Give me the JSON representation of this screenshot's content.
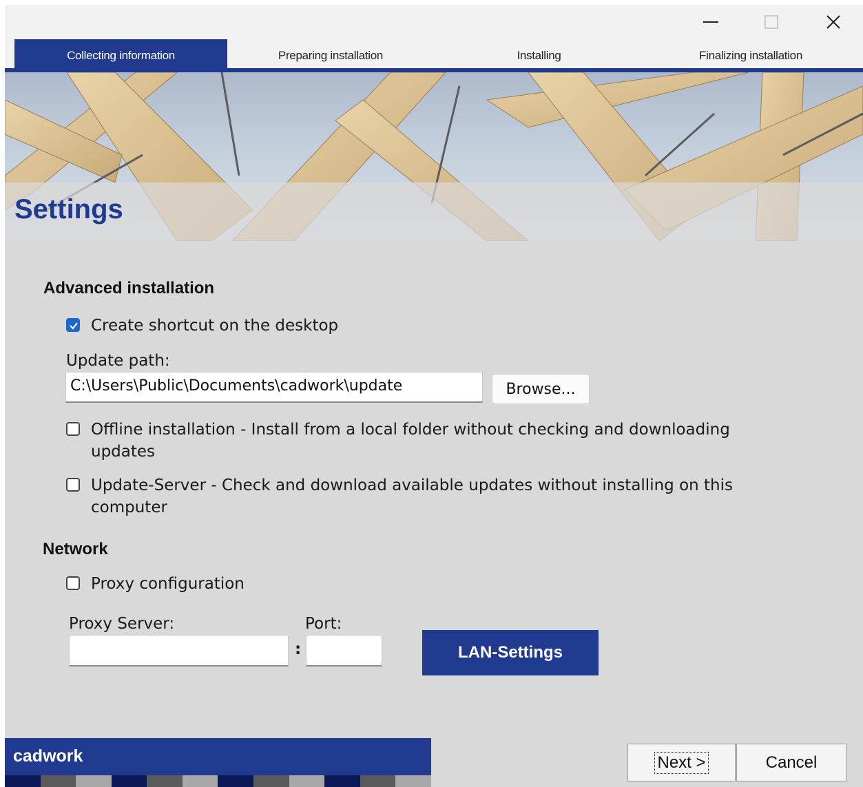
{
  "window": {
    "controls": {
      "minimize_icon": "minimize-icon",
      "maximize_icon": "maximize-icon",
      "close_icon": "close-icon"
    }
  },
  "steps": [
    {
      "label": "Collecting information",
      "active": true
    },
    {
      "label": "Preparing installation",
      "active": false
    },
    {
      "label": "Installing",
      "active": false
    },
    {
      "label": "Finalizing installation",
      "active": false
    }
  ],
  "page": {
    "title": "Settings"
  },
  "advanced": {
    "heading": "Advanced installation",
    "shortcut_label": "Create shortcut on the desktop",
    "shortcut_checked": true,
    "update_path_label": "Update path:",
    "update_path_value": "C:\\Users\\Public\\Documents\\cadwork\\update",
    "browse_label": "Browse...",
    "offline_label_line1": "Offline installation - Install from a local folder without checking and downloading",
    "offline_label_line2": "updates",
    "offline_checked": false,
    "update_server_label_line1": "Update-Server - Check and download available updates without installing on this",
    "update_server_label_line2": "computer",
    "update_server_checked": false
  },
  "network": {
    "heading": "Network",
    "proxy_label": "Proxy configuration",
    "proxy_checked": false,
    "proxy_server_label": "Proxy Server:",
    "proxy_server_value": "",
    "separator": ":",
    "port_label": "Port:",
    "port_value": "",
    "lan_settings_label": "LAN-Settings"
  },
  "footer": {
    "brand": "cadwork",
    "next_label": "Next >",
    "cancel_label": "Cancel"
  },
  "colors": {
    "accent": "#1f3a8f",
    "checkbox_checked": "#1e66c8",
    "background": "#d9d9d9"
  }
}
